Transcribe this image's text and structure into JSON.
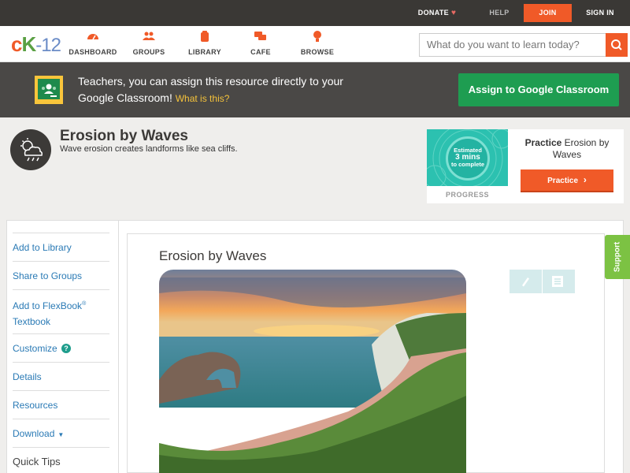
{
  "topbar": {
    "donate": "DONATE",
    "help": "HELP",
    "join": "JOIN",
    "sign_in": "SIGN IN"
  },
  "logo": {
    "c": "c",
    "k": "K",
    "n": "-12"
  },
  "nav": {
    "items": [
      {
        "label": "DASHBOARD",
        "icon": "dashboard-icon"
      },
      {
        "label": "GROUPS",
        "icon": "groups-icon"
      },
      {
        "label": "LIBRARY",
        "icon": "library-icon"
      },
      {
        "label": "CAFE",
        "icon": "cafe-icon"
      },
      {
        "label": "BROWSE",
        "icon": "browse-icon"
      }
    ],
    "search_placeholder": "What do you want to learn today?"
  },
  "banner": {
    "text": "Teachers, you can assign this resource directly to your Google Classroom!",
    "link": "What is this?",
    "button": "Assign to Google Classroom"
  },
  "header": {
    "title": "Erosion by Waves",
    "subtitle": "Wave erosion creates landforms like sea cliffs."
  },
  "practice": {
    "estimate_l1": "Estimated",
    "estimate_l2": "3 mins",
    "estimate_l3": "to complete",
    "progress_label": "PROGRESS",
    "title_bold": "Practice",
    "title_rest": "Erosion by Waves",
    "button": "Practice"
  },
  "sidebar": {
    "add_library": "Add to Library",
    "share_groups": "Share to Groups",
    "add_flexbook_1": "Add to FlexBook",
    "add_flexbook_reg": "®",
    "add_flexbook_2": "Textbook",
    "customize": "Customize",
    "customize_help": "?",
    "details": "Details",
    "resources": "Resources",
    "download": "Download",
    "quick_tips": "Quick Tips"
  },
  "content": {
    "title": "Erosion by Waves"
  },
  "support": "Support",
  "colors": {
    "brand_orange": "#f05a28",
    "google_green": "#1e9d51",
    "link_blue": "#2a7ab5",
    "support_green": "#7cc243"
  }
}
